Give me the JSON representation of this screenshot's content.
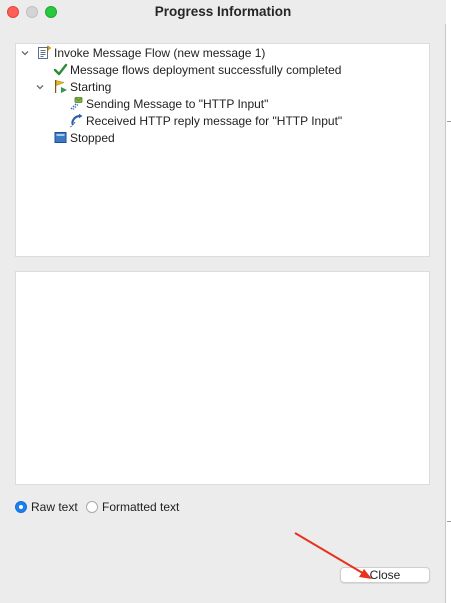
{
  "window": {
    "title": "Progress Information"
  },
  "tree": {
    "root": {
      "label": "Invoke Message Flow (new message 1)",
      "icon": "invoke-flow-icon",
      "expanded": true
    },
    "children": [
      {
        "label": "Message flows deployment successfully completed",
        "icon": "checkmark-icon"
      },
      {
        "label": "Starting",
        "icon": "starting-flag-icon",
        "expanded": true,
        "children": [
          {
            "label": "Sending Message to \"HTTP Input\"",
            "icon": "send-message-icon"
          },
          {
            "label": "Received HTTP reply message for \"HTTP Input\"",
            "icon": "receive-message-icon"
          }
        ]
      },
      {
        "label": "Stopped",
        "icon": "stopped-icon"
      }
    ]
  },
  "format": {
    "options": [
      "Raw text",
      "Formatted text"
    ],
    "selected": "Raw text"
  },
  "buttons": {
    "close_label": "Close"
  },
  "colors": {
    "accent": "#1a7ff0",
    "annotation_arrow": "#e8321f",
    "checkmark": "#2e8b3a"
  }
}
